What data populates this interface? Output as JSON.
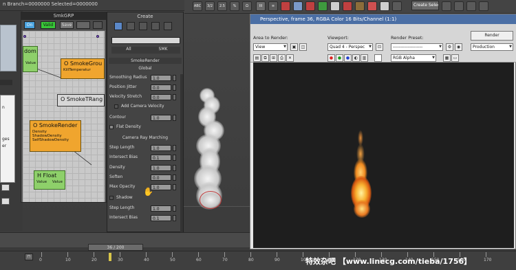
{
  "topbar": {
    "branch_text": "n   Branch=0000000   Selected=0000000"
  },
  "main_toolbar": {
    "selection_set": "Create Selection Se",
    "buttons": [
      "ABC",
      "3/2",
      "2.5",
      "%",
      "Ω",
      "III",
      "≡",
      "🗀"
    ]
  },
  "smk_window": {
    "title": "SmkGRP",
    "toolbar": {
      "on": "On",
      "valid": "Valid",
      "save": "Save"
    },
    "nodes": {
      "random": {
        "title": "dom",
        "value": "Value"
      },
      "smoke_group": {
        "title": "O SmokeGrou",
        "sub": "KillTemperatur"
      },
      "smoke_trange": {
        "title": "O SmokeTRang"
      },
      "smoke_render": {
        "title": "O SmokeRender",
        "inputs": [
          "Density",
          "ShadowDensity",
          "SelfShadowDensity"
        ]
      },
      "float": {
        "title": "H Float",
        "left": "Value",
        "right": "Value"
      }
    }
  },
  "left_fragments": [
    "n",
    "ges",
    "er"
  ],
  "create_panel": {
    "title": "Create",
    "tabs": {
      "all": "All",
      "smk": "SMK"
    },
    "rollout_title": "SmokeRender",
    "global_label": "Global",
    "params": [
      {
        "label": "Smoothing Radius",
        "value": "1.0"
      },
      {
        "label": "Position Jitter",
        "value": "0.0"
      },
      {
        "label": "Velocity Stretch",
        "value": "0.0"
      }
    ],
    "add_camera_velocity": "Add Camera Velocity",
    "contour": {
      "label": "Contour",
      "value": "1.0"
    },
    "flat_density": "Flat Density",
    "camera_ray_marching": "Camera Ray Marching",
    "ray_params": [
      {
        "label": "Step Length",
        "value": "1.0"
      },
      {
        "label": "Intersect Bias",
        "value": "0.1"
      },
      {
        "label": "Density",
        "value": "1.0"
      },
      {
        "label": "Soften",
        "value": "0.0"
      },
      {
        "label": "Max Opacity",
        "value": "1.0"
      }
    ],
    "shadow": "Shadow",
    "shadow_params": [
      {
        "label": "Step Length",
        "value": "1.0"
      },
      {
        "label": "Intersect Bias",
        "value": "0.1"
      }
    ]
  },
  "render_window": {
    "title": "Perspective, frame 36, RGBA Color 16 Bits/Channel (1:1)",
    "area_to_render_label": "Area to Render:",
    "area_to_render_value": "View",
    "viewport_label": "Viewport:",
    "viewport_value": "Quad 4 - Perspec",
    "render_preset_label": "Render Preset:",
    "render_preset_value": "--------------------",
    "render_button": "Render",
    "render_mode": "Production",
    "channel_value": "RGB Alpha"
  },
  "timeline": {
    "frame_display": "36 / 200",
    "ticks": [
      "0",
      "10",
      "20",
      "30",
      "40",
      "50",
      "60",
      "70",
      "80",
      "90",
      "100",
      "110",
      "120",
      "130",
      "140",
      "150",
      "160",
      "170"
    ]
  },
  "watermark": "特效杂吧 【www.linecg.com/tieba/1756】"
}
